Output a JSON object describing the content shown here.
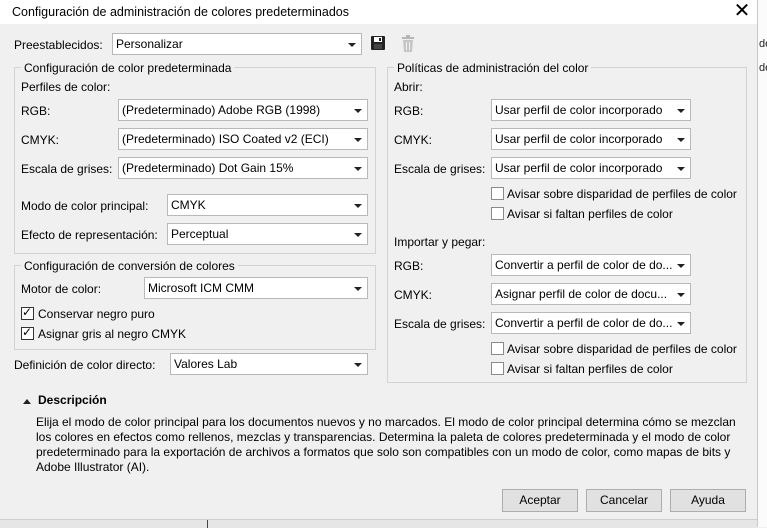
{
  "window": {
    "title": "Configuración de administración de colores predeterminados",
    "close": "✕"
  },
  "presets": {
    "label": "Preestablecidos:",
    "value": "Personalizar"
  },
  "default_color": {
    "legend": "Configuración de color predeterminada",
    "profiles_label": "Perfiles de color:",
    "rgb_label": "RGB:",
    "rgb_value": "(Predeterminado) Adobe RGB (1998)",
    "cmyk_label": "CMYK:",
    "cmyk_value": "(Predeterminado) ISO Coated v2 (ECI)",
    "gray_label": "Escala de grises:",
    "gray_value": "(Predeterminado) Dot Gain 15%",
    "mode_label": "Modo de color principal:",
    "mode_value": "CMYK",
    "intent_label": "Efecto de representación:",
    "intent_value": "Perceptual"
  },
  "conversion": {
    "legend": "Configuración de conversión de colores",
    "engine_label": "Motor de color:",
    "engine_value": "Microsoft ICM CMM",
    "preserve_black": "Conservar negro puro",
    "preserve_black_checked": true,
    "map_gray": "Asignar gris al negro CMYK",
    "map_gray_checked": true
  },
  "spot": {
    "label": "Definición de color directo:",
    "value": "Valores Lab"
  },
  "policies": {
    "legend": "Políticas de administración del color",
    "open_label": "Abrir:",
    "open_rgb_label": "RGB:",
    "open_rgb_value": "Usar perfil de color incorporado",
    "open_cmyk_label": "CMYK:",
    "open_cmyk_value": "Usar perfil de color incorporado",
    "open_gray_label": "Escala de grises:",
    "open_gray_value": "Usar perfil de color incorporado",
    "open_warn_mismatch": "Avisar sobre disparidad de perfiles de color",
    "open_warn_missing": "Avisar si faltan perfiles de color",
    "import_label": "Importar y pegar:",
    "imp_rgb_label": "RGB:",
    "imp_rgb_value": "Convertir a perfil de color de do...",
    "imp_cmyk_label": "CMYK:",
    "imp_cmyk_value": "Asignar perfil de color de docu...",
    "imp_gray_label": "Escala de grises:",
    "imp_gray_value": "Convertir a perfil de color de do...",
    "imp_warn_mismatch": "Avisar sobre disparidad de perfiles de color",
    "imp_warn_missing": "Avisar si faltan perfiles de color"
  },
  "description": {
    "heading": "Descripción",
    "text": "Elija el modo de color principal para los documentos nuevos y no marcados. El modo de color principal determina cómo se mezclan los colores en efectos como rellenos, mezclas y transparencias. Determina la paleta de colores predeterminada y el modo de color predeterminado para la exportación de archivos a formatos que solo son compatibles con un modo de color, como mapas de bits y Adobe Illustrator (AI)."
  },
  "buttons": {
    "ok": "Aceptar",
    "cancel": "Cancelar",
    "help": "Ayuda"
  },
  "side_fragments": [
    "de",
    "de"
  ]
}
